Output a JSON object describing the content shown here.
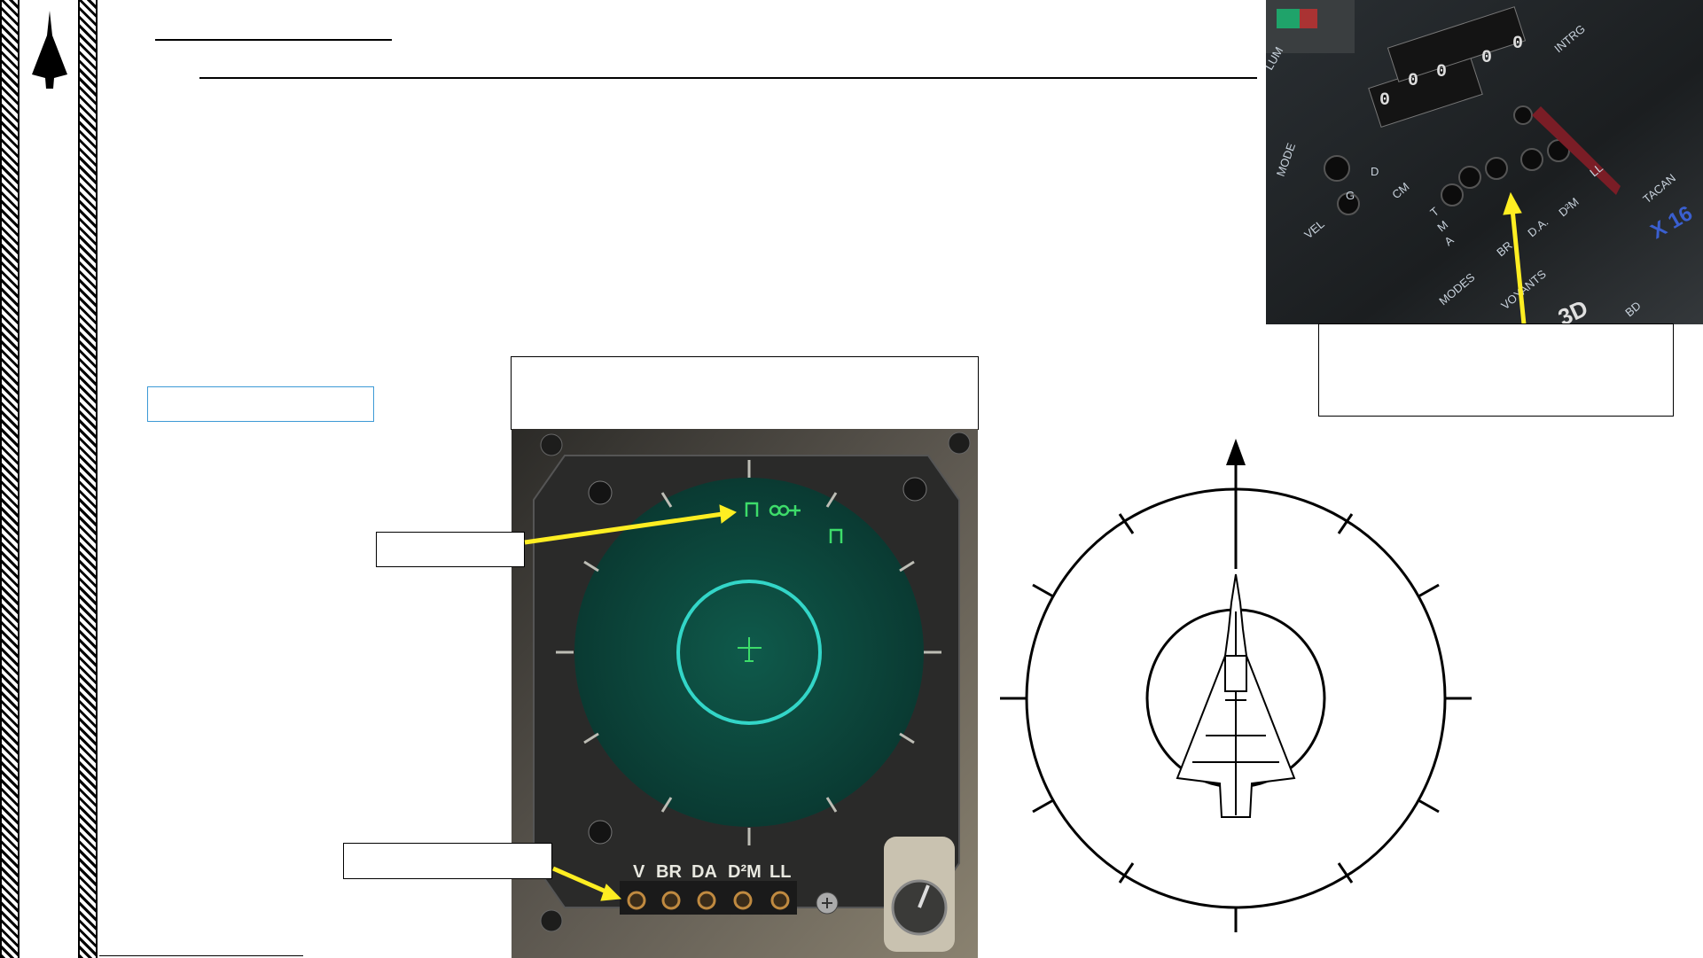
{
  "sidebar": {
    "logo_icon": "delta-wing-aircraft-icon"
  },
  "header": {
    "title": "",
    "subtitle": ""
  },
  "side_link": {
    "label": ""
  },
  "display_caption": {
    "text": ""
  },
  "photo_caption": {
    "text": ""
  },
  "callouts": {
    "symbols": "",
    "buttons": ""
  },
  "radar_display": {
    "screen_color": "#0d4a3f",
    "ring_color": "#33d6c8",
    "symbol_color": "#3ddc6a",
    "mode_buttons": [
      "V",
      "BR",
      "DA",
      "D²M",
      "LL"
    ]
  },
  "cockpit_panel": {
    "labels": [
      "LUM",
      "MODE",
      "D",
      "G",
      "VEL",
      "CM",
      "T",
      "M",
      "A",
      "BR",
      "D.A.",
      "D²M",
      "LL",
      "INTRG",
      "TACAN",
      "MODES",
      "VOYANTS",
      "BD",
      "X 16",
      "3D"
    ],
    "counter_digits": [
      "0",
      "0",
      "0",
      "0",
      "0"
    ],
    "arrow_color": "#ffee22"
  },
  "annotation_arrow_color": "#ffee22",
  "diagram": {
    "icon": "aircraft-topview-icon"
  }
}
